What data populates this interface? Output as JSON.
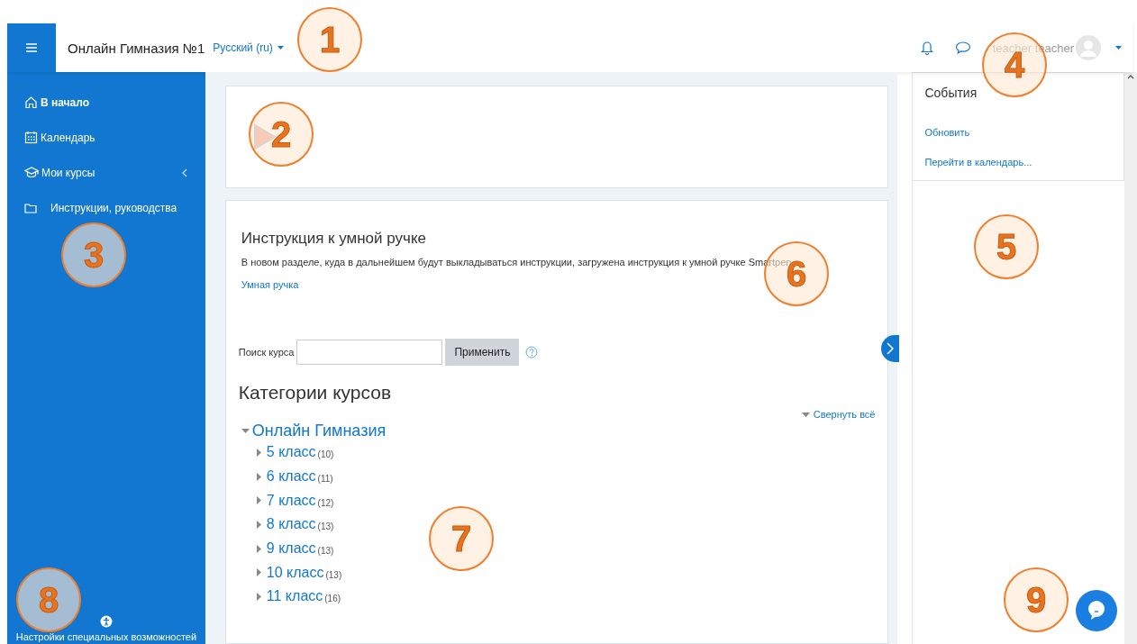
{
  "header": {
    "title": "Онлайн Гимназия №1",
    "language": "Русский (ru)",
    "user_name": "teacher teacher"
  },
  "nav": [
    {
      "label": "В начало",
      "kind": "home",
      "selected": true
    },
    {
      "label": "Календарь",
      "kind": "calendar",
      "selected": false
    },
    {
      "label": "Мои курсы",
      "kind": "courses",
      "selected": false
    },
    {
      "label": "Инструкции, руководства",
      "kind": "folder",
      "selected": false
    }
  ],
  "accessibility_label": "Настройки специальных возможностей",
  "notice": {
    "title": "Инструкция к умной ручке",
    "text": "В новом разделе, куда в дальнейшем будут выкладываться инструкции, загружена инструкция к умной ручке Smartpen",
    "link": "Умная ручка"
  },
  "search": {
    "label": "Поиск курса",
    "button": "Применить"
  },
  "categories": {
    "title": "Категории курсов",
    "collapse_all": "Свернуть всё",
    "root": {
      "name": "Онлайн Гимназия",
      "expanded": true,
      "children": [
        {
          "name": "5 класс",
          "count": "(10)",
          "expanded": false
        },
        {
          "name": "6 класс",
          "count": "(11)",
          "expanded": false
        },
        {
          "name": "7 класс",
          "count": "(12)",
          "expanded": false
        },
        {
          "name": "8 класс",
          "count": "(13)",
          "expanded": false
        },
        {
          "name": "9 класс",
          "count": "(13)",
          "expanded": false
        },
        {
          "name": "10 класс",
          "count": "(13)",
          "expanded": false
        },
        {
          "name": "11 класс",
          "count": "(16)",
          "expanded": false
        }
      ]
    }
  },
  "events_block": {
    "title": "События",
    "links": [
      "Обновить",
      "Перейти в календарь..."
    ]
  },
  "annotations": [
    "1",
    "2",
    "3",
    "4",
    "5",
    "6",
    "7",
    "8",
    "9"
  ]
}
